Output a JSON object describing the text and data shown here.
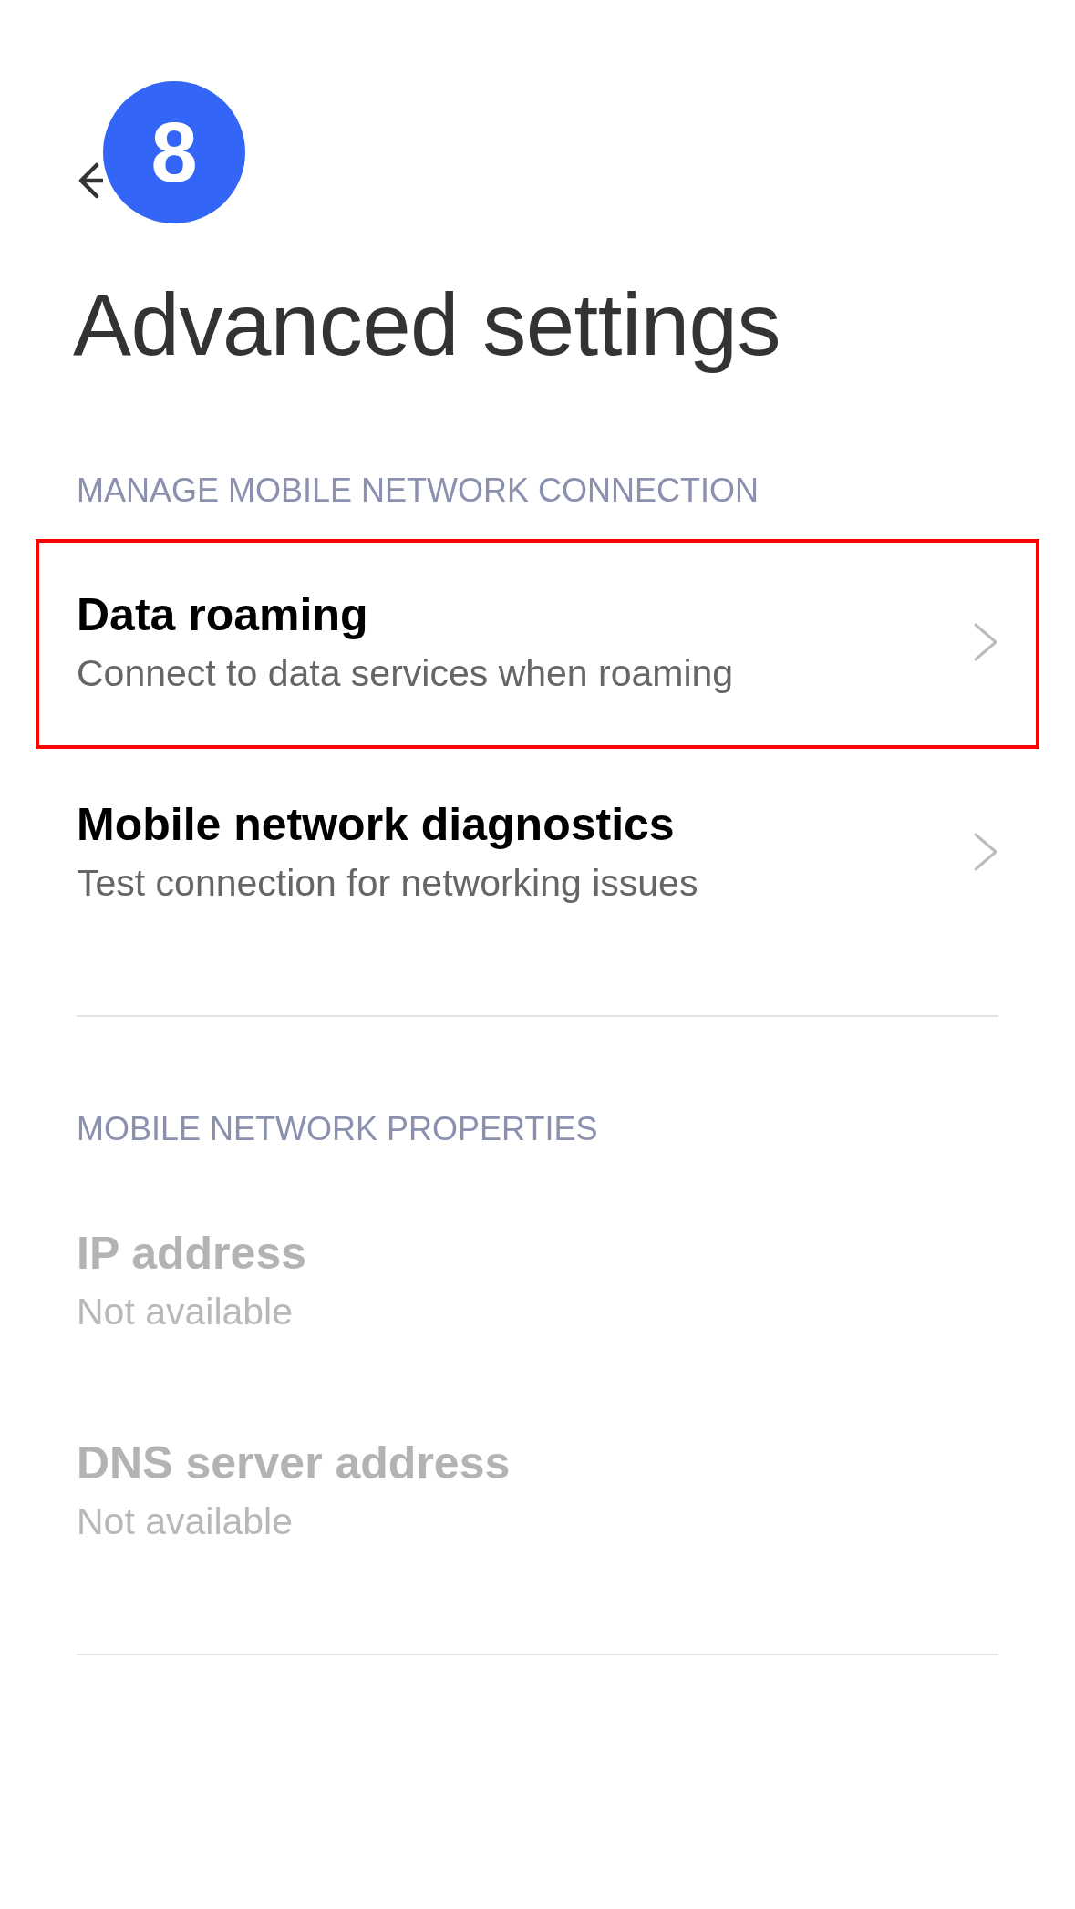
{
  "step_badge": {
    "label": "8"
  },
  "title": "Advanced settings",
  "sections": [
    {
      "heading": "MANAGE MOBILE NETWORK CONNECTION",
      "items": [
        {
          "kind": "link",
          "title": "Data roaming",
          "subtitle": "Connect to data services when roaming",
          "disabled": false,
          "highlighted": true
        },
        {
          "kind": "link",
          "title": "Mobile network diagnostics",
          "subtitle": "Test connection for networking issues",
          "disabled": false,
          "highlighted": false
        }
      ]
    },
    {
      "heading": "MOBILE NETWORK PROPERTIES",
      "items": [
        {
          "kind": "info",
          "title": "IP address",
          "subtitle": "Not available",
          "disabled": true
        },
        {
          "kind": "info",
          "title": "DNS server address",
          "subtitle": "Not available",
          "disabled": true
        }
      ]
    }
  ]
}
